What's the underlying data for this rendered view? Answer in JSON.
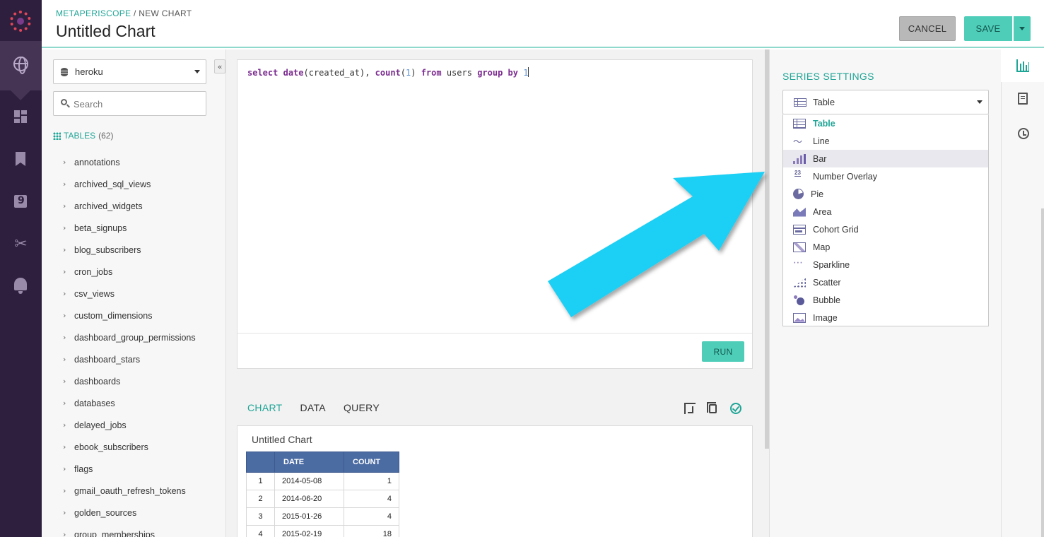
{
  "header": {
    "breadcrumb_app": "METAPERISCOPE",
    "breadcrumb_sep": " / ",
    "breadcrumb_page": "NEW CHART",
    "title": "Untitled Chart",
    "cancel_label": "CANCEL",
    "save_label": "SAVE"
  },
  "rail": {
    "icons": [
      "logo-icon",
      "globe-icon",
      "dashboard-icon",
      "bookmark-icon",
      "quote-icon",
      "scissors-icon",
      "bell-icon"
    ]
  },
  "schema": {
    "database": "heroku",
    "search_placeholder": "Search",
    "tables_label": "TABLES",
    "tables_count": "(62)",
    "tables": [
      "annotations",
      "archived_sql_views",
      "archived_widgets",
      "beta_signups",
      "blog_subscribers",
      "cron_jobs",
      "csv_views",
      "custom_dimensions",
      "dashboard_group_permissions",
      "dashboard_stars",
      "dashboards",
      "databases",
      "delayed_jobs",
      "ebook_subscribers",
      "flags",
      "gmail_oauth_refresh_tokens",
      "golden_sources",
      "group_memberships"
    ]
  },
  "editor": {
    "run_label": "RUN",
    "sql_tokens": [
      {
        "t": "select",
        "k": "kw"
      },
      {
        "t": " ",
        "k": ""
      },
      {
        "t": "date",
        "k": "kw"
      },
      {
        "t": "(created_at), ",
        "k": ""
      },
      {
        "t": "count",
        "k": "kw"
      },
      {
        "t": "(",
        "k": ""
      },
      {
        "t": "1",
        "k": "num"
      },
      {
        "t": ") ",
        "k": ""
      },
      {
        "t": "from",
        "k": "kw"
      },
      {
        "t": " users ",
        "k": ""
      },
      {
        "t": "group by",
        "k": "kw"
      },
      {
        "t": " ",
        "k": ""
      },
      {
        "t": "1",
        "k": "num"
      }
    ]
  },
  "results": {
    "tabs": [
      "CHART",
      "DATA",
      "QUERY"
    ],
    "active_tab": "CHART",
    "chart_title": "Untitled Chart",
    "columns": [
      "",
      "DATE",
      "COUNT"
    ],
    "rows": [
      [
        "1",
        "2014-05-08",
        "1"
      ],
      [
        "2",
        "2014-06-20",
        "4"
      ],
      [
        "3",
        "2015-01-26",
        "4"
      ],
      [
        "4",
        "2015-02-19",
        "18"
      ]
    ]
  },
  "series": {
    "heading": "SERIES SETTINGS",
    "selected": "Table",
    "options": [
      {
        "label": "Table",
        "icon": "table"
      },
      {
        "label": "Line",
        "icon": "line"
      },
      {
        "label": "Bar",
        "icon": "bar"
      },
      {
        "label": "Number Overlay",
        "icon": "num"
      },
      {
        "label": "Pie",
        "icon": "pie"
      },
      {
        "label": "Area",
        "icon": "area"
      },
      {
        "label": "Cohort Grid",
        "icon": "cohort"
      },
      {
        "label": "Map",
        "icon": "map"
      },
      {
        "label": "Sparkline",
        "icon": "spark"
      },
      {
        "label": "Scatter",
        "icon": "scatter"
      },
      {
        "label": "Bubble",
        "icon": "bubble"
      },
      {
        "label": "Image",
        "icon": "image"
      }
    ],
    "hovered": "Bar"
  },
  "colors": {
    "accent": "#1fa596",
    "button": "#4ecdb8",
    "rail": "#2d1f3d",
    "table_header": "#4b6ba3",
    "arrow": "#1fcff4"
  }
}
